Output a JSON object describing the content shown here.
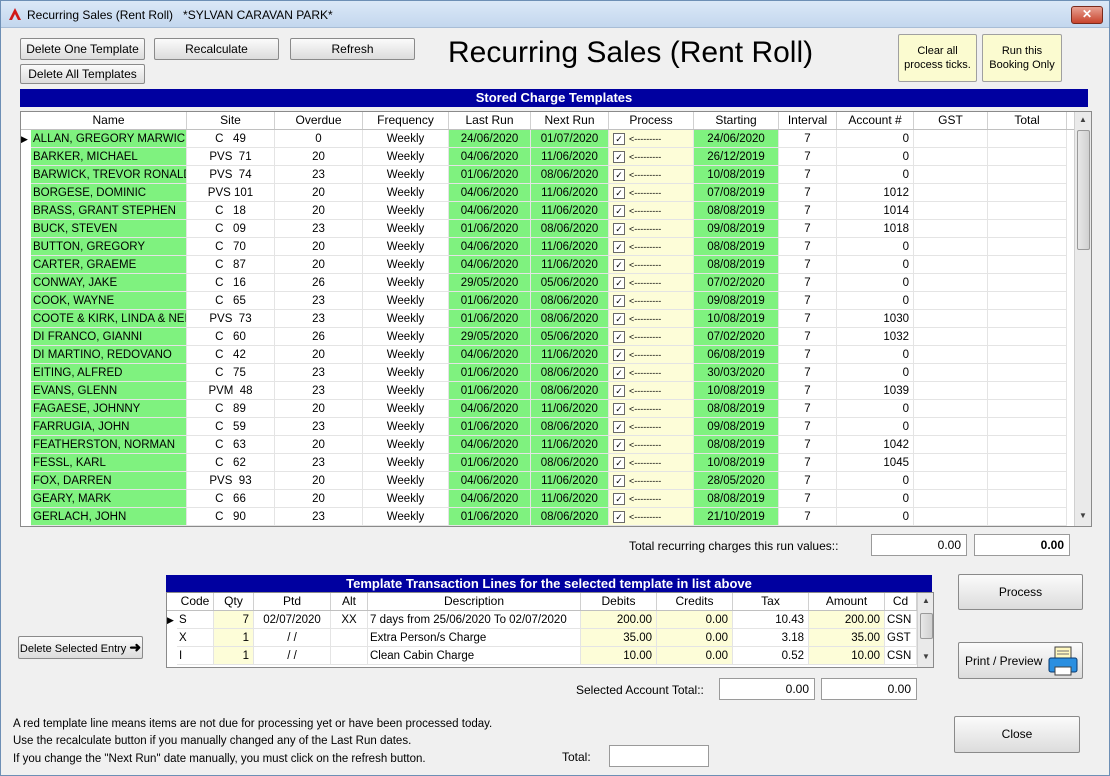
{
  "window": {
    "title": "Recurring Sales (Rent Roll)   *SYLVAN CARAVAN PARK*",
    "close_glyph": "✕"
  },
  "toolbar": {
    "delete_one_label": "Delete One Template",
    "delete_all_label": "Delete All Templates",
    "recalculate_label": "Recalculate",
    "refresh_label": "Refresh",
    "clear_all_label": "Clear all process ticks.",
    "run_booking_label": "Run this Booking Only"
  },
  "page_title": "Recurring Sales (Rent Roll)",
  "templates": {
    "banner": "Stored Charge Templates",
    "columns": [
      "Name",
      "Site",
      "Overdue",
      "Frequency",
      "Last Run",
      "Next Run",
      "Process",
      "Starting",
      "Interval",
      "Account #",
      "GST",
      "Total"
    ],
    "process_arrow": "<---------",
    "rows": [
      {
        "name": "ALLAN, GREGORY MARWICK",
        "site": "C   49",
        "overdue": "0",
        "freq": "Weekly",
        "last": "24/06/2020",
        "next": "01/07/2020",
        "start": "24/06/2020",
        "interval": "7",
        "account": "0"
      },
      {
        "name": "BARKER, MICHAEL",
        "site": "PVS  71",
        "overdue": "20",
        "freq": "Weekly",
        "last": "04/06/2020",
        "next": "11/06/2020",
        "start": "26/12/2019",
        "interval": "7",
        "account": "0"
      },
      {
        "name": "BARWICK, TREVOR RONALD",
        "site": "PVS  74",
        "overdue": "23",
        "freq": "Weekly",
        "last": "01/06/2020",
        "next": "08/06/2020",
        "start": "10/08/2019",
        "interval": "7",
        "account": "0"
      },
      {
        "name": "BORGESE, DOMINIC",
        "site": "PVS 101",
        "overdue": "20",
        "freq": "Weekly",
        "last": "04/06/2020",
        "next": "11/06/2020",
        "start": "07/08/2019",
        "interval": "7",
        "account": "1012"
      },
      {
        "name": "BRASS, GRANT STEPHEN",
        "site": "C   18",
        "overdue": "20",
        "freq": "Weekly",
        "last": "04/06/2020",
        "next": "11/06/2020",
        "start": "08/08/2019",
        "interval": "7",
        "account": "1014"
      },
      {
        "name": "BUCK, STEVEN",
        "site": "C   09",
        "overdue": "23",
        "freq": "Weekly",
        "last": "01/06/2020",
        "next": "08/06/2020",
        "start": "09/08/2019",
        "interval": "7",
        "account": "1018"
      },
      {
        "name": "BUTTON, GREGORY",
        "site": "C   70",
        "overdue": "20",
        "freq": "Weekly",
        "last": "04/06/2020",
        "next": "11/06/2020",
        "start": "08/08/2019",
        "interval": "7",
        "account": "0"
      },
      {
        "name": "CARTER, GRAEME",
        "site": "C   87",
        "overdue": "20",
        "freq": "Weekly",
        "last": "04/06/2020",
        "next": "11/06/2020",
        "start": "08/08/2019",
        "interval": "7",
        "account": "0"
      },
      {
        "name": "CONWAY, JAKE",
        "site": "C   16",
        "overdue": "26",
        "freq": "Weekly",
        "last": "29/05/2020",
        "next": "05/06/2020",
        "start": "07/02/2020",
        "interval": "7",
        "account": "0"
      },
      {
        "name": "COOK, WAYNE",
        "site": "C   65",
        "overdue": "23",
        "freq": "Weekly",
        "last": "01/06/2020",
        "next": "08/06/2020",
        "start": "09/08/2019",
        "interval": "7",
        "account": "0"
      },
      {
        "name": "COOTE & KIRK, LINDA & NEIL",
        "site": "PVS  73",
        "overdue": "23",
        "freq": "Weekly",
        "last": "01/06/2020",
        "next": "08/06/2020",
        "start": "10/08/2019",
        "interval": "7",
        "account": "1030"
      },
      {
        "name": "DI FRANCO, GIANNI",
        "site": "C   60",
        "overdue": "26",
        "freq": "Weekly",
        "last": "29/05/2020",
        "next": "05/06/2020",
        "start": "07/02/2020",
        "interval": "7",
        "account": "1032"
      },
      {
        "name": "DI MARTINO, REDOVANO",
        "site": "C   42",
        "overdue": "20",
        "freq": "Weekly",
        "last": "04/06/2020",
        "next": "11/06/2020",
        "start": "06/08/2019",
        "interval": "7",
        "account": "0"
      },
      {
        "name": "EITING, ALFRED",
        "site": "C   75",
        "overdue": "23",
        "freq": "Weekly",
        "last": "01/06/2020",
        "next": "08/06/2020",
        "start": "30/03/2020",
        "interval": "7",
        "account": "0"
      },
      {
        "name": "EVANS, GLENN",
        "site": "PVM  48",
        "overdue": "23",
        "freq": "Weekly",
        "last": "01/06/2020",
        "next": "08/06/2020",
        "start": "10/08/2019",
        "interval": "7",
        "account": "1039"
      },
      {
        "name": "FAGAESE, JOHNNY",
        "site": "C   89",
        "overdue": "20",
        "freq": "Weekly",
        "last": "04/06/2020",
        "next": "11/06/2020",
        "start": "08/08/2019",
        "interval": "7",
        "account": "0"
      },
      {
        "name": "FARRUGIA, JOHN",
        "site": "C   59",
        "overdue": "23",
        "freq": "Weekly",
        "last": "01/06/2020",
        "next": "08/06/2020",
        "start": "09/08/2019",
        "interval": "7",
        "account": "0"
      },
      {
        "name": "FEATHERSTON, NORMAN",
        "site": "C   63",
        "overdue": "20",
        "freq": "Weekly",
        "last": "04/06/2020",
        "next": "11/06/2020",
        "start": "08/08/2019",
        "interval": "7",
        "account": "1042"
      },
      {
        "name": "FESSL, KARL",
        "site": "C   62",
        "overdue": "23",
        "freq": "Weekly",
        "last": "01/06/2020",
        "next": "08/06/2020",
        "start": "10/08/2019",
        "interval": "7",
        "account": "1045"
      },
      {
        "name": "FOX, DARREN",
        "site": "PVS  93",
        "overdue": "20",
        "freq": "Weekly",
        "last": "04/06/2020",
        "next": "11/06/2020",
        "start": "28/05/2020",
        "interval": "7",
        "account": "0"
      },
      {
        "name": "GEARY, MARK",
        "site": "C   66",
        "overdue": "20",
        "freq": "Weekly",
        "last": "04/06/2020",
        "next": "11/06/2020",
        "start": "08/08/2019",
        "interval": "7",
        "account": "0"
      },
      {
        "name": "GERLACH, JOHN",
        "site": "C   90",
        "overdue": "23",
        "freq": "Weekly",
        "last": "01/06/2020",
        "next": "08/06/2020",
        "start": "21/10/2019",
        "interval": "7",
        "account": "0"
      }
    ]
  },
  "totals": {
    "recurring_label": "Total recurring charges this  run values::",
    "recurring_value_1": "0.00",
    "recurring_value_2": "0.00"
  },
  "lines": {
    "banner": "Template Transaction Lines for the selected template in list above",
    "columns": [
      "Code",
      "Qty",
      "Ptd",
      "Alt",
      "Description",
      "Debits",
      "Credits",
      "Tax",
      "Amount",
      "Cd"
    ],
    "rows": [
      {
        "code": "S",
        "qty": "7",
        "ptd": "02/07/2020",
        "alt": "XX",
        "desc": "7 days from 25/06/2020 To 02/07/2020",
        "debits": "200.00",
        "credits": "0.00",
        "tax": "10.43",
        "amount": "200.00",
        "cd": "CSN"
      },
      {
        "code": "X",
        "qty": "1",
        "ptd": "/ /",
        "alt": "",
        "desc": "Extra Person/s Charge",
        "debits": "35.00",
        "credits": "0.00",
        "tax": "3.18",
        "amount": "35.00",
        "cd": "GST"
      },
      {
        "code": "I",
        "qty": "1",
        "ptd": "/ /",
        "alt": "",
        "desc": "Clean Cabin Charge",
        "debits": "10.00",
        "credits": "0.00",
        "tax": "0.52",
        "amount": "10.00",
        "cd": "CSN"
      }
    ]
  },
  "actions": {
    "delete_entry_label": "Delete Selected Entry",
    "process_label": "Process",
    "print_label": "Print / Preview",
    "close_label": "Close"
  },
  "account_total": {
    "label": "Selected Account Total::",
    "value_1": "0.00",
    "value_2": "0.00"
  },
  "notes": [
    "A red template line means items are not due  for processing yet or have been processed today.",
    "Use the recalculate button if you manually changed any of the Last Run dates.",
    "If you change the \"Next Run\" date manually, you must click on the refresh button."
  ],
  "total_label": "Total:",
  "total_value": "",
  "colors": {
    "banner": "#0000a0",
    "green": "#7ff27f",
    "cream": "#fdfdd8"
  }
}
